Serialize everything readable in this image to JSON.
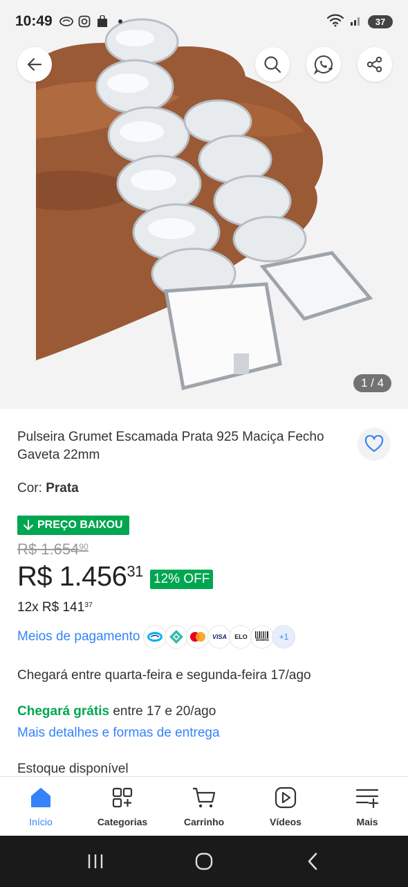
{
  "status_bar": {
    "time": "10:49",
    "battery": "37"
  },
  "gallery": {
    "counter": "1 / 4"
  },
  "product": {
    "title": "Pulseira Grumet Escamada Prata 925 Maciça Fecho Gaveta 22mm",
    "color_label": "Cor: ",
    "color_value": "Prata",
    "badge": "PREÇO BAIXOU",
    "old_price_main": "R$ 1.654",
    "old_price_cents": "90",
    "price_main": "R$ 1.456",
    "price_cents": "31",
    "discount": "12% OFF",
    "installments_main": "12x R$ 141",
    "installments_cents": "37",
    "payments_link": "Meios de pagamento",
    "payment_more": "+1",
    "arrival": "Chegará entre quarta-feira e segunda-feira 17/ago",
    "free_ship_label": "Chegará grátis",
    "free_ship_rest": " entre 17 e 20/ago",
    "more_details": "Mais detalhes e formas de entrega",
    "stock": "Estoque disponível"
  },
  "payment_icons": [
    "mercado-pago-icon",
    "pix-icon",
    "mastercard-icon",
    "visa-icon",
    "elo-icon",
    "boleto-icon"
  ],
  "payment_icon_labels": {
    "visa": "VISA",
    "elo": "ELO",
    "boleto": "Boleto"
  },
  "bottom_nav": {
    "items": [
      {
        "label": "Início"
      },
      {
        "label": "Categorias"
      },
      {
        "label": "Carrinho"
      },
      {
        "label": "Vídeos"
      },
      {
        "label": "Mais"
      }
    ]
  },
  "colors": {
    "accent": "#3483fa",
    "green": "#00a650",
    "text": "#333333"
  }
}
